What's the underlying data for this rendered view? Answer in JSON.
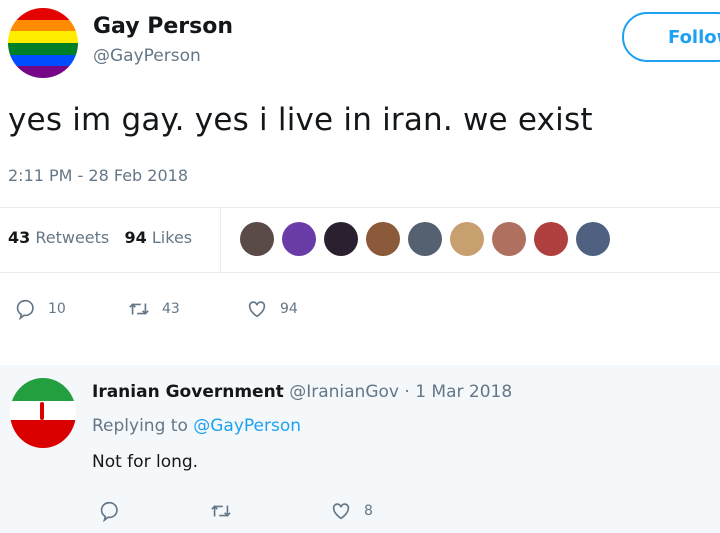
{
  "tweet": {
    "name": "Gay Person",
    "handle": "@GayPerson",
    "follow_label": "Follow",
    "text": "yes im gay. yes i live in iran. we exist",
    "timestamp": "2:11 PM - 28 Feb 2018",
    "retweets": "43",
    "retweets_label": "Retweets",
    "likes": "94",
    "likes_label": "Likes",
    "likers_colors": [
      "#5a4a48",
      "#6a3ca8",
      "#2a2030",
      "#8a5a3a",
      "#556070",
      "#c8a070",
      "#b07060",
      "#b04040",
      "#506080"
    ],
    "actions": {
      "replies": "10",
      "retweets": "43",
      "likes": "94"
    }
  },
  "reply": {
    "name": "Iranian Government",
    "handle": "@IranianGov",
    "date": "1 Mar 2018",
    "replying_prefix": "Replying to",
    "replying_to": "@GayPerson",
    "text": "Not for long.",
    "actions": {
      "likes": "8"
    }
  }
}
